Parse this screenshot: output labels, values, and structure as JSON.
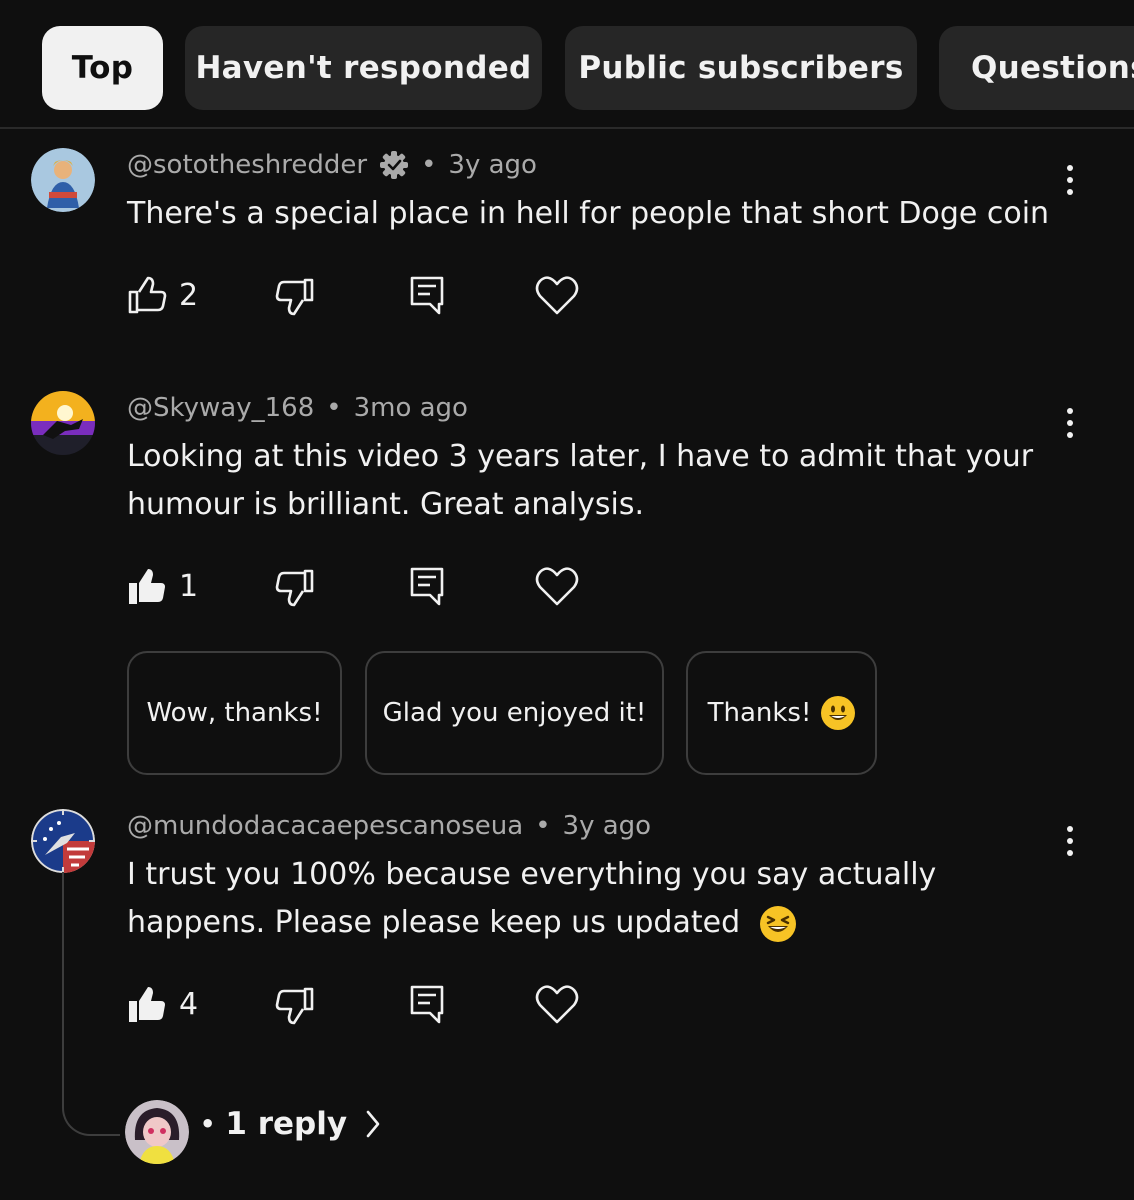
{
  "filters": {
    "top": "Top",
    "not_responded": "Haven't responded",
    "public_subscribers": "Public subscribers",
    "questions": "Questions"
  },
  "comments": [
    {
      "author": "@sototheshredder",
      "badge_icon": "verified-gear-icon",
      "time": "3y ago",
      "text": "There's a special place in hell for people that short Doge coin",
      "likes": "2",
      "liked": false
    },
    {
      "author": "@Skyway_168",
      "time": "3mo ago",
      "text": "Looking at this video 3 years later, I have to admit that your humour is brilliant. Great analysis.",
      "likes": "1",
      "liked": true
    },
    {
      "author": "@mundodacacaepescanoseua",
      "time": "3y ago",
      "text": "I trust you 100% because everything you say actually happens. Please please keep us updated",
      "text_emoji": "laughing-face-emoji",
      "likes": "4",
      "liked": true
    }
  ],
  "quick_replies": {
    "first": "Wow, thanks!",
    "second": "Glad you enjoyed it!",
    "third": "Thanks!",
    "third_emoji": "smiley-face-emoji"
  },
  "thread": {
    "separator": "•",
    "reply_label": "1 reply"
  },
  "meta_separator": "•",
  "colors": {
    "background": "#0f0f0f",
    "chip": "#262626",
    "chip_active": "#f1f1f1",
    "text_secondary": "#aaaaaa",
    "emoji_yellow": "#f7c325"
  }
}
